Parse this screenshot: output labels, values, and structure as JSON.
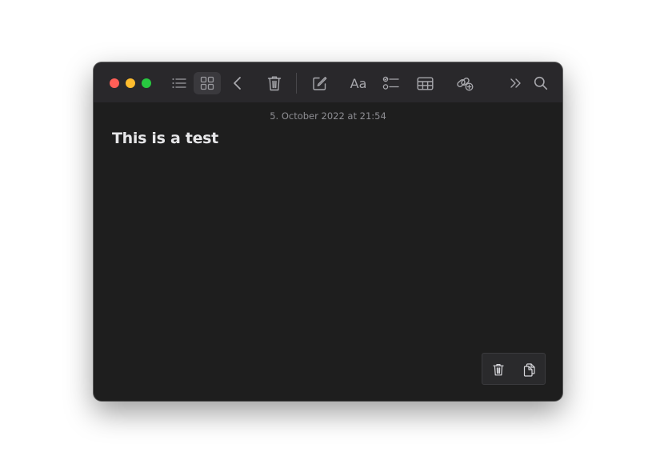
{
  "window": {
    "traffic_lights": {
      "close_color": "#ff5f57",
      "minimize_color": "#febc2e",
      "zoom_color": "#28c840"
    }
  },
  "toolbar": {
    "buttons": [
      {
        "icon": "list-view-icon",
        "state": "normal"
      },
      {
        "icon": "gallery-view-icon",
        "state": "selected"
      },
      {
        "icon": "back-chevron-icon",
        "state": "normal"
      },
      {
        "icon": "trash-icon",
        "state": "normal"
      },
      {
        "icon": "compose-icon",
        "state": "normal"
      },
      {
        "icon": "format-icon",
        "state": "normal"
      },
      {
        "icon": "checklist-icon",
        "state": "normal"
      },
      {
        "icon": "table-icon",
        "state": "normal"
      },
      {
        "icon": "collaborate-icon",
        "state": "normal"
      },
      {
        "icon": "overflow-chevrons-icon",
        "state": "normal"
      },
      {
        "icon": "search-icon",
        "state": "normal"
      }
    ],
    "format_label": "Aa",
    "overflow_label": "»"
  },
  "note": {
    "date": "5. October 2022 at 21:54",
    "title": "This is a test"
  },
  "floating_bar": {
    "buttons": [
      {
        "icon": "trash-icon"
      },
      {
        "icon": "copy-icon"
      }
    ]
  },
  "colors": {
    "window_bg": "#1e1e1e",
    "toolbar_bg": "#29282b",
    "icon": "#a8a8ad",
    "title_text": "#e6e6e8",
    "date_text": "#8e8e93"
  }
}
